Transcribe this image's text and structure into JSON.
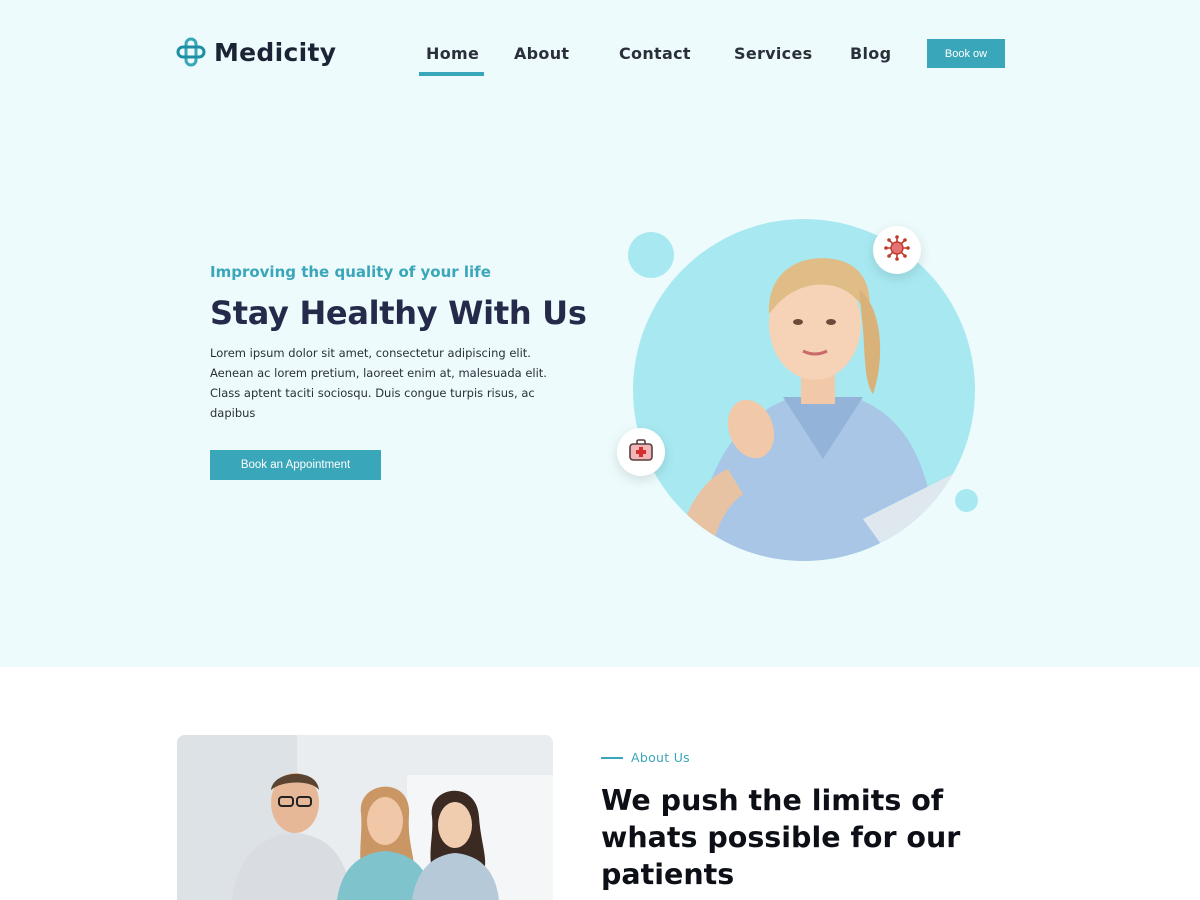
{
  "brand": {
    "name": "Medicity",
    "logo_icon": "medical-cross-logo-icon",
    "accent_color": "#3aa6b9"
  },
  "nav": {
    "items": [
      {
        "label": "Home",
        "active": true
      },
      {
        "label": "About",
        "active": false
      },
      {
        "label": "Contact",
        "active": false
      },
      {
        "label": "Services",
        "active": false
      },
      {
        "label": "Blog",
        "active": false
      }
    ],
    "cta_label": "Book ow"
  },
  "hero": {
    "tagline": "Improving the quality of your life",
    "title": "Stay Healthy With Us",
    "body": "Lorem ipsum dolor sit amet, consectetur adipiscing elit. Aenean ac lorem pretium, laoreet enim at, malesuada elit. Class aptent taciti sociosqu. Duis congue turpis risus, ac dapibus",
    "button_label": "Book an Appointment",
    "badges": [
      "virus-icon",
      "first-aid-kit-icon"
    ],
    "image": "doctor-photo"
  },
  "about": {
    "eyebrow": "About Us",
    "title": "We push the limits of whats possible for our patients",
    "image": "medical-team-photo"
  }
}
